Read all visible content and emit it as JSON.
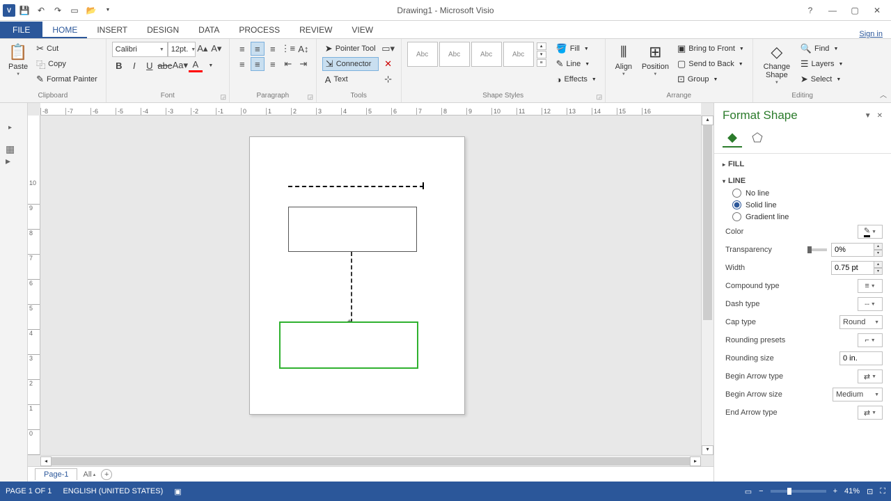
{
  "title": "Drawing1 - Microsoft Visio",
  "signin": "Sign in",
  "tabs": {
    "file": "FILE",
    "home": "HOME",
    "insert": "INSERT",
    "design": "DESIGN",
    "data": "DATA",
    "process": "PROCESS",
    "review": "REVIEW",
    "view": "VIEW"
  },
  "clipboard": {
    "paste": "Paste",
    "cut": "Cut",
    "copy": "Copy",
    "format_painter": "Format Painter",
    "label": "Clipboard"
  },
  "font": {
    "name": "Calibri",
    "size": "12pt.",
    "label": "Font"
  },
  "paragraph_label": "Paragraph",
  "tools": {
    "pointer": "Pointer Tool",
    "connector": "Connector",
    "text": "Text",
    "label": "Tools"
  },
  "shape_styles": {
    "sample": "Abc",
    "label": "Shape Styles",
    "fill": "Fill",
    "line": "Line",
    "effects": "Effects"
  },
  "arrange": {
    "align": "Align",
    "position": "Position",
    "bring_front": "Bring to Front",
    "send_back": "Send to Back",
    "group": "Group",
    "label": "Arrange"
  },
  "editing": {
    "change_shape": "Change Shape",
    "find": "Find",
    "layers": "Layers",
    "select": "Select",
    "label": "Editing"
  },
  "ruler_h": [
    "-8",
    "-7",
    "-6",
    "-5",
    "-4",
    "-3",
    "-2",
    "-1",
    "0",
    "1",
    "2",
    "3",
    "4",
    "5",
    "6",
    "7",
    "8",
    "9",
    "10",
    "11",
    "12",
    "13",
    "14",
    "15",
    "16"
  ],
  "ruler_v": [
    "0",
    "1",
    "2",
    "3",
    "4",
    "5",
    "6",
    "7",
    "8",
    "9",
    "10"
  ],
  "page_tabs": {
    "page1": "Page-1",
    "all": "All"
  },
  "format_pane": {
    "title": "Format Shape",
    "fill": "FILL",
    "line": "LINE",
    "no_line": "No line",
    "solid_line": "Solid line",
    "gradient_line": "Gradient line",
    "color": "Color",
    "transparency": "Transparency",
    "transparency_val": "0%",
    "width": "Width",
    "width_val": "0.75 pt",
    "compound": "Compound type",
    "dash": "Dash type",
    "cap": "Cap type",
    "cap_val": "Round",
    "rounding_presets": "Rounding presets",
    "rounding_size": "Rounding size",
    "rounding_size_val": "0 in.",
    "begin_arrow_type": "Begin Arrow type",
    "begin_arrow_size": "Begin Arrow size",
    "begin_arrow_size_val": "Medium",
    "end_arrow_type": "End Arrow type"
  },
  "status": {
    "page": "PAGE 1 OF 1",
    "lang": "ENGLISH (UNITED STATES)",
    "zoom": "41%"
  }
}
